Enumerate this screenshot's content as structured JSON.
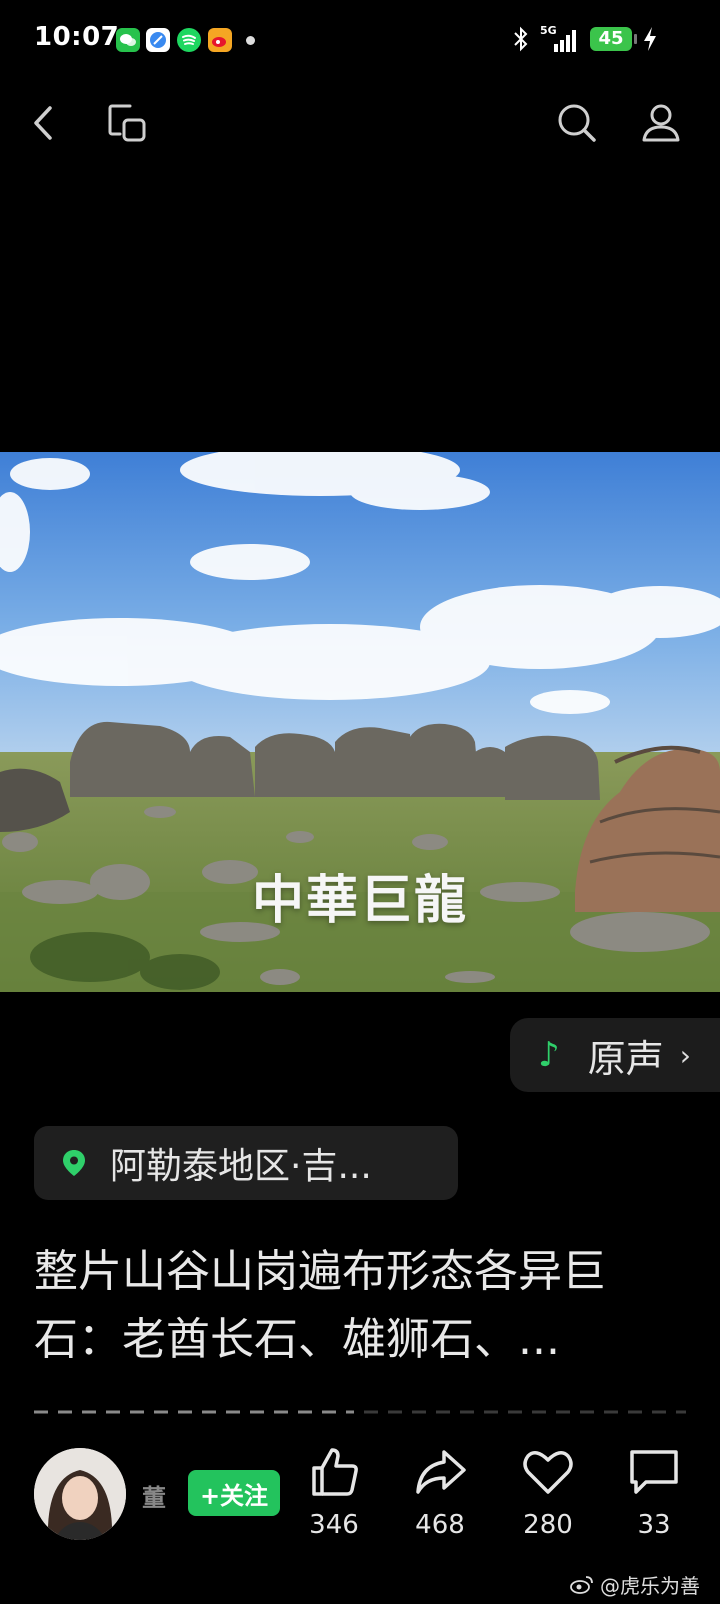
{
  "status_bar": {
    "time": "10:07",
    "network": "5G",
    "battery": "45",
    "icons": [
      "wechat-icon",
      "browser-icon",
      "spotify-icon",
      "weibo-icon",
      "dot-icon",
      "bluetooth-icon",
      "signal-icon",
      "charging-icon"
    ]
  },
  "top_bar": {
    "icons": [
      "back-icon",
      "window-switch-icon",
      "search-icon",
      "profile-icon"
    ]
  },
  "media": {
    "caption": "中華巨龍"
  },
  "sound": {
    "label": "原声"
  },
  "location": {
    "label": "阿勒泰地区·吉..."
  },
  "description": {
    "line1": "整片山谷山岗遍布形态各异巨",
    "line2": "石：老酋长石、雄狮石、..."
  },
  "author": {
    "name": "董",
    "follow_label": "+关注"
  },
  "actions": [
    {
      "name": "like",
      "count": "346"
    },
    {
      "name": "share",
      "count": "468"
    },
    {
      "name": "favorite",
      "count": "280"
    },
    {
      "name": "comment",
      "count": "33"
    }
  ],
  "watermark": {
    "text": "@虎乐为善"
  },
  "colors": {
    "accent_green": "#23c35d",
    "background": "#000000",
    "chip_bg": "#1f1f1f"
  }
}
